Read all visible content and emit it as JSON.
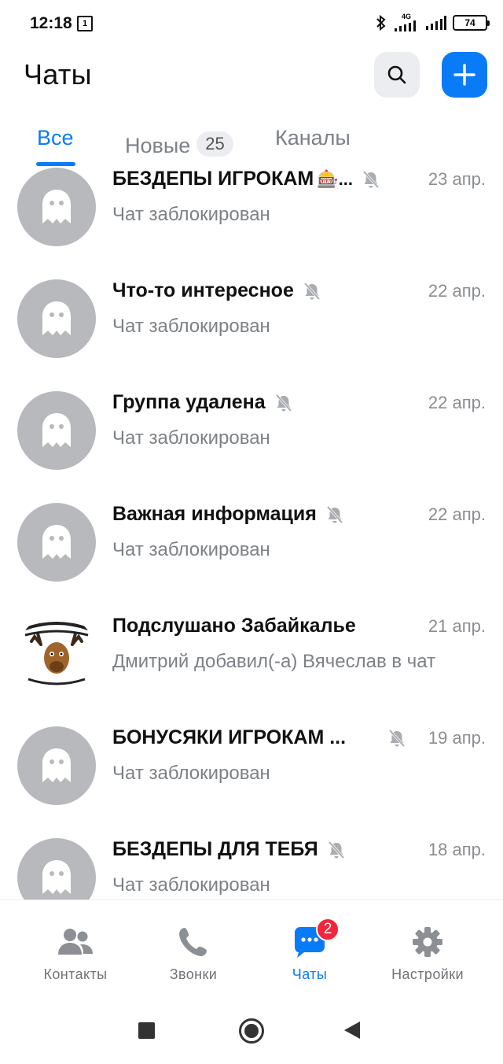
{
  "status_bar": {
    "time": "12:18",
    "notification_count": "1",
    "network": "4G",
    "battery": "74"
  },
  "header": {
    "title": "Чаты"
  },
  "tabs": {
    "all": "Все",
    "new": "Новые",
    "new_count": "25",
    "channels": "Каналы",
    "active": "all"
  },
  "chats": [
    {
      "title": "БЕЗДЕПЫ ИГРОКАМ",
      "emoji": "🎰...",
      "muted": true,
      "subtitle": "Чат заблокирован",
      "date": "23 апр."
    },
    {
      "title": "Что-то интересное",
      "muted": true,
      "subtitle": "Чат заблокирован",
      "date": "22 апр."
    },
    {
      "title": "Группа удалена",
      "muted": true,
      "subtitle": "Чат заблокирован",
      "date": "22 апр."
    },
    {
      "title": "Важная информация",
      "muted": true,
      "subtitle": "Чат заблокирован",
      "date": "22 апр."
    },
    {
      "title": "Подслушано Забайкалье",
      "muted": false,
      "subtitle": "Дмитрий добавил(-а) Вячеслав в чат",
      "date": "21 апр."
    },
    {
      "title": "БОНУСЯКИ ИГРОКАМ ...",
      "muted": true,
      "subtitle": "Чат заблокирован",
      "date": "19 апр."
    },
    {
      "title": "БЕЗДЕПЫ ДЛЯ ТЕБЯ",
      "muted": true,
      "subtitle": "Чат заблокирован",
      "date": "18 апр."
    }
  ],
  "bottom_nav": {
    "contacts": "Контакты",
    "calls": "Звонки",
    "chats": "Чаты",
    "chats_badge": "2",
    "settings": "Настройки",
    "active": "chats"
  },
  "colors": {
    "accent": "#0a7bf6",
    "badge": "#f2263b",
    "avatar_gray": "#b7b9bc"
  }
}
